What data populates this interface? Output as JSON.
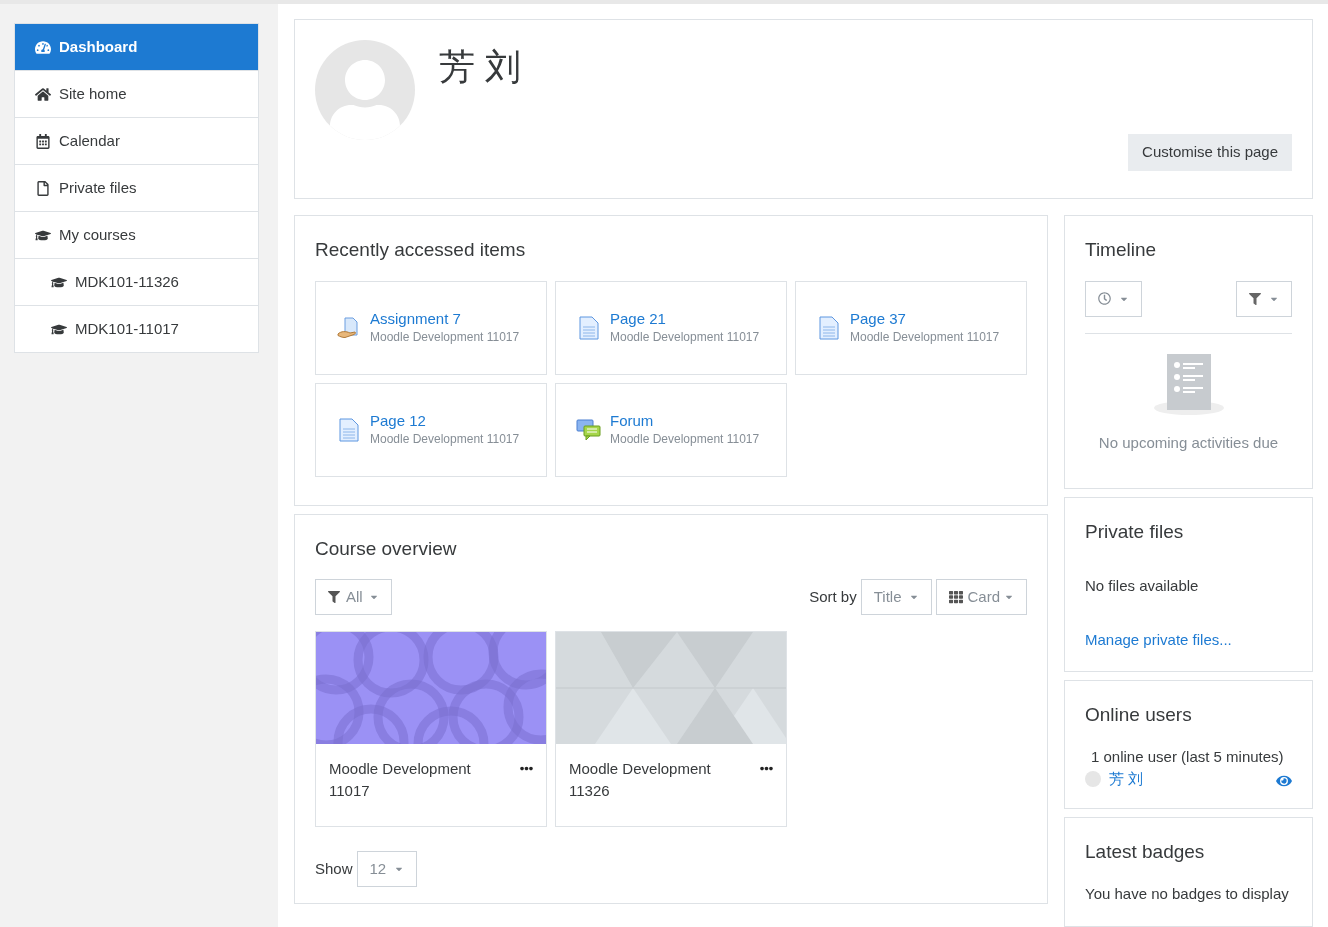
{
  "nav": [
    {
      "label": "Dashboard",
      "kind": "dashboard",
      "selected": true
    },
    {
      "label": "Site home",
      "kind": "home",
      "selected": false
    },
    {
      "label": "Calendar",
      "kind": "calendar",
      "selected": false
    },
    {
      "label": "Private files",
      "kind": "file",
      "selected": false
    },
    {
      "label": "My courses",
      "kind": "courses",
      "selected": false,
      "children": [
        {
          "label": "MDK101-11326",
          "kind": "courses",
          "selected": false
        },
        {
          "label": "MDK101-11017",
          "kind": "courses",
          "selected": false
        }
      ]
    }
  ],
  "profile": {
    "name": "芳 刘",
    "customise_button": "Customise this page"
  },
  "recent": {
    "title": "Recently accessed items",
    "items": [
      {
        "kind": "assignment",
        "name": "Assignment 7",
        "course": "Moodle Development 11017"
      },
      {
        "kind": "page",
        "name": "Page 21",
        "course": "Moodle Development 11017"
      },
      {
        "kind": "page",
        "name": "Page 37",
        "course": "Moodle Development 11017"
      },
      {
        "kind": "page",
        "name": "Page 12",
        "course": "Moodle Development 11017"
      },
      {
        "kind": "forum",
        "name": "Forum",
        "course": "Moodle Development 11017"
      }
    ]
  },
  "course_overview": {
    "title": "Course overview",
    "filter": "All",
    "sort_label": "Sort by",
    "sort": "Title",
    "view": "Card",
    "courses": [
      {
        "name": "Moodle Development 11017",
        "kind": "circles"
      },
      {
        "name": "Moodle Development 11326",
        "kind": "triangles"
      }
    ],
    "show_label": "Show",
    "show": "12"
  },
  "timeline": {
    "title": "Timeline",
    "empty": "No upcoming activities due"
  },
  "private_files": {
    "title": "Private files",
    "empty": "No files available",
    "link": "Manage private files..."
  },
  "online_users": {
    "title": "Online users",
    "summary": "1 online user (last 5 minutes)",
    "users": [
      "芳 刘"
    ]
  },
  "badges": {
    "title": "Latest badges",
    "empty": "You have no badges to display"
  }
}
